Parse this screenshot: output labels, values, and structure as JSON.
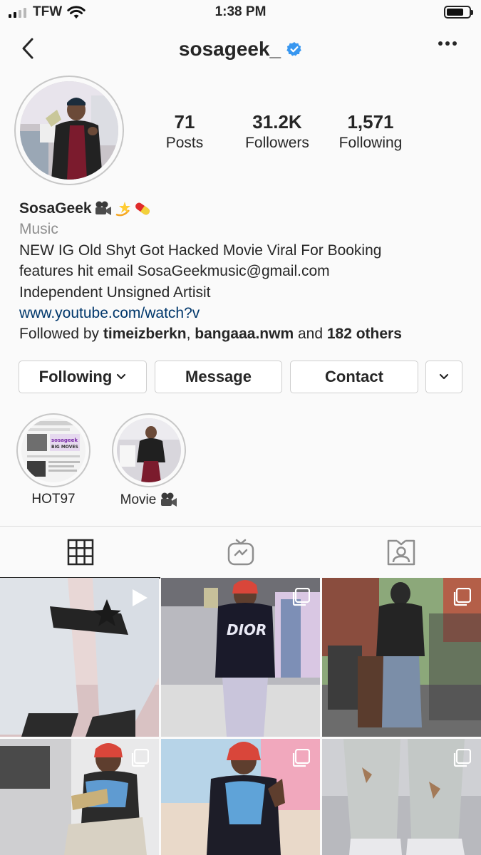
{
  "status_bar": {
    "carrier": "TFW",
    "time": "1:38 PM",
    "battery_level": 0.75
  },
  "nav": {
    "username": "sosageek_"
  },
  "stats": [
    {
      "count": "71",
      "label": "Posts"
    },
    {
      "count": "31.2K",
      "label": "Followers"
    },
    {
      "count": "1,571",
      "label": "Following"
    }
  ],
  "bio": {
    "name": "SosaGeek",
    "category": "Music",
    "lines": [
      "NEW IG Old Shyt Got Hacked Movie Viral For Booking",
      "features hit email SosaGeekmusic@gmail.com",
      "Independent Unsigned Artisit"
    ],
    "link": "www.youtube.com/watch?v",
    "followed_by_prefix": "Followed by ",
    "followed_by_user1": "timeizberkn",
    "followed_by_sep": ", ",
    "followed_by_user2": "bangaaa.nwm",
    "followed_by_and": " and ",
    "followed_by_others": "182 others"
  },
  "buttons": {
    "following": "Following",
    "message": "Message",
    "contact": "Contact"
  },
  "highlights": [
    {
      "label": "HOT97"
    },
    {
      "label": "Movie"
    }
  ],
  "highlight_preview_text": "sosageek BIG MOVES",
  "tabs": [
    "grid-tab",
    "igtv-tab",
    "tagged-tab"
  ],
  "colors": {
    "link": "#00376b",
    "verified": "#3897f0",
    "secondary_text": "#8e8e8e",
    "border": "#dbdbdb"
  }
}
